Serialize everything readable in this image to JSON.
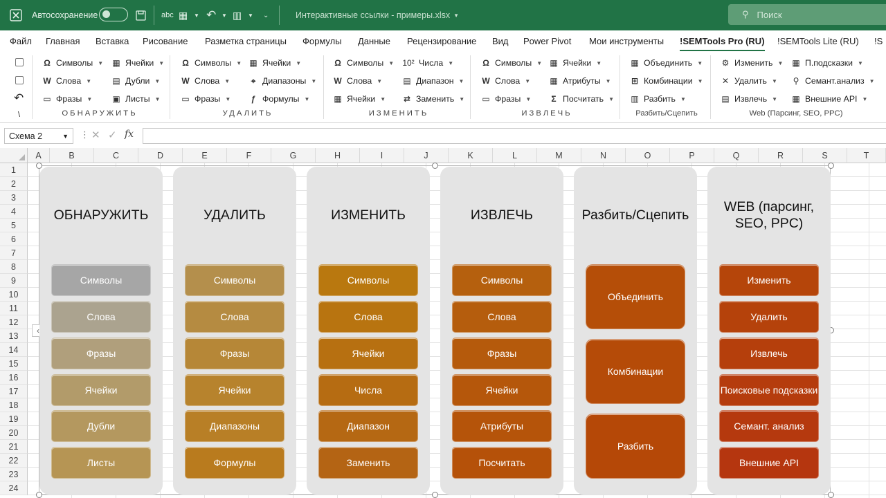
{
  "titlebar": {
    "autosave_label": "Автосохранение",
    "filename": "Интерактивные ссылки - примеры.xlsx",
    "search_placeholder": "Поиск"
  },
  "menu": {
    "tabs": [
      "Файл",
      "Главная",
      "Вставка",
      "Рисование",
      "Разметка страницы",
      "Формулы",
      "Данные",
      "Рецензирование",
      "Вид",
      "Power Pivot",
      "Мои инструменты",
      "!SEMTools Pro (RU)",
      "!SEMTools Lite (RU)"
    ],
    "active": "!SEMTools Pro (RU)"
  },
  "ribbon": {
    "groups": [
      {
        "label": "ОБНАРУЖИТЬ",
        "items": [
          "Символы",
          "Слова",
          "Фразы",
          "Ячейки",
          "Дубли",
          "Листы"
        ]
      },
      {
        "label": "УДАЛИТЬ",
        "items": [
          "Символы",
          "Слова",
          "Фразы",
          "Ячейки",
          "Диапазоны",
          "Формулы"
        ]
      },
      {
        "label": "ИЗМЕНИТЬ",
        "items": [
          "Символы",
          "Слова",
          "Ячейки",
          "Числа",
          "Диапазон",
          "Заменить"
        ]
      },
      {
        "label": "ИЗВЛЕЧЬ",
        "items": [
          "Символы",
          "Слова",
          "Фразы",
          "Ячейки",
          "Атрибуты",
          "Посчитать"
        ]
      },
      {
        "label": "Разбить/Сцепить",
        "items": [
          "Объединить",
          "Комбинации",
          "Разбить"
        ]
      },
      {
        "label": "Web (Парсинг, SEO, PPC)",
        "items": [
          "Изменить",
          "Удалить",
          "Извлечь",
          "П.подсказки",
          "Семант.анализ",
          "Внешние API"
        ]
      }
    ],
    "numbers_icon_text": "10²",
    "backslash": "\\"
  },
  "formula_bar": {
    "name_box": "Схема 2",
    "fx": "fx",
    "value": ""
  },
  "grid": {
    "columns": [
      "A",
      "B",
      "C",
      "D",
      "E",
      "F",
      "G",
      "H",
      "I",
      "J",
      "K",
      "L",
      "M",
      "N",
      "O",
      "P",
      "Q",
      "R",
      "S",
      "T"
    ],
    "rows": [
      "1",
      "2",
      "3",
      "4",
      "5",
      "6",
      "7",
      "8",
      "9",
      "10",
      "11",
      "12",
      "13",
      "14",
      "15",
      "16",
      "17",
      "18",
      "19",
      "20",
      "21",
      "22",
      "23",
      "24"
    ]
  },
  "smartart": {
    "columns": [
      {
        "title": "ОБНАРУЖИТЬ",
        "buttons": [
          "Символы",
          "Слова",
          "Фразы",
          "Ячейки",
          "Дубли",
          "Листы"
        ],
        "colors": [
          "#a6a6a6",
          "#aba38f",
          "#b09f7c",
          "#b29b6a",
          "#b4985f",
          "#b69554"
        ]
      },
      {
        "title": "УДАЛИТЬ",
        "buttons": [
          "Символы",
          "Слова",
          "Фразы",
          "Ячейки",
          "Диапазоны",
          "Формулы"
        ],
        "colors": [
          "#b48f4c",
          "#b58b41",
          "#b68737",
          "#b7832d",
          "#b87f26",
          "#b97b1e"
        ]
      },
      {
        "title": "ИЗМЕНИТЬ",
        "buttons": [
          "Символы",
          "Слова",
          "Ячейки",
          "Числа",
          "Диапазон",
          "Заменить"
        ],
        "colors": [
          "#b9780f",
          "#b87410",
          "#b77011",
          "#b66c12",
          "#b56813",
          "#b46414"
        ]
      },
      {
        "title": "ИЗВЛЕЧЬ",
        "buttons": [
          "Символы",
          "Слова",
          "Фразы",
          "Ячейки",
          "Атрибуты",
          "Посчитать"
        ],
        "colors": [
          "#b5600e",
          "#b55d0d",
          "#b55a0c",
          "#b5570b",
          "#b5540a",
          "#b55109"
        ]
      },
      {
        "title": "Разбить/Сцепить",
        "buttons": [
          "Объединить",
          "Комбинации",
          "Разбить"
        ],
        "colors": [
          "#b54e08",
          "#b54b08",
          "#b54807"
        ]
      },
      {
        "title": "WEB (парсинг, SEO, PPC)",
        "buttons": [
          "Изменить",
          "Удалить",
          "Извлечь",
          "Поисковые подсказки",
          "Семант. анализ",
          "Внешние API"
        ],
        "colors": [
          "#b5450a",
          "#b5420b",
          "#b53f0c",
          "#b53c0d",
          "#b5390e",
          "#b5360f"
        ]
      }
    ]
  }
}
